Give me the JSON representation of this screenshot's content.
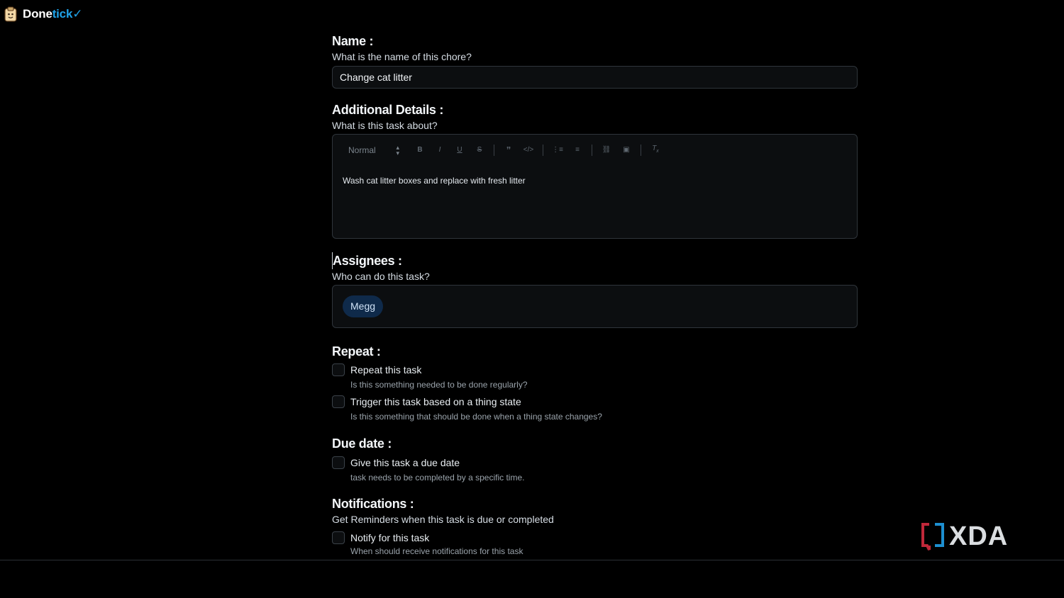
{
  "app": {
    "brand_primary": "Done",
    "brand_accent": "tick✓",
    "accent_color": "#1fa2e8"
  },
  "form": {
    "name": {
      "title": "Name :",
      "subtitle": "What is the name of this chore?",
      "value": "Change cat litter"
    },
    "details": {
      "title": "Additional Details :",
      "subtitle": "What is this task about?",
      "toolbar": {
        "format_select": "Normal",
        "icons": [
          "bold-icon",
          "italic-icon",
          "underline-icon",
          "strikethrough-icon",
          "blockquote-icon",
          "code-icon",
          "ordered-list-icon",
          "bullet-list-icon",
          "link-icon",
          "image-icon",
          "clear-format-icon"
        ]
      },
      "body": "Wash cat litter boxes and replace with fresh litter"
    },
    "assignees": {
      "title": "Assignees :",
      "subtitle": "Who can do this task?",
      "chips": [
        "Megg"
      ]
    },
    "repeat": {
      "title": "Repeat :",
      "options": [
        {
          "label": "Repeat this task",
          "hint": "Is this something needed to be done regularly?",
          "checked": false
        },
        {
          "label": "Trigger this task based on a thing state",
          "hint": "Is this something that should be done when a thing state changes?",
          "checked": false
        }
      ]
    },
    "due_date": {
      "title": "Due date :",
      "options": [
        {
          "label": "Give this task a due date",
          "hint": "task needs to be completed by a specific time.",
          "checked": false
        }
      ]
    },
    "notifications": {
      "title": "Notifications :",
      "subtitle": "Get Reminders when this task is due or completed",
      "options": [
        {
          "label": "Notify for this task",
          "hint": "When should receive notifications for this task",
          "checked": false
        }
      ]
    }
  },
  "watermark": {
    "text": "XDA"
  }
}
